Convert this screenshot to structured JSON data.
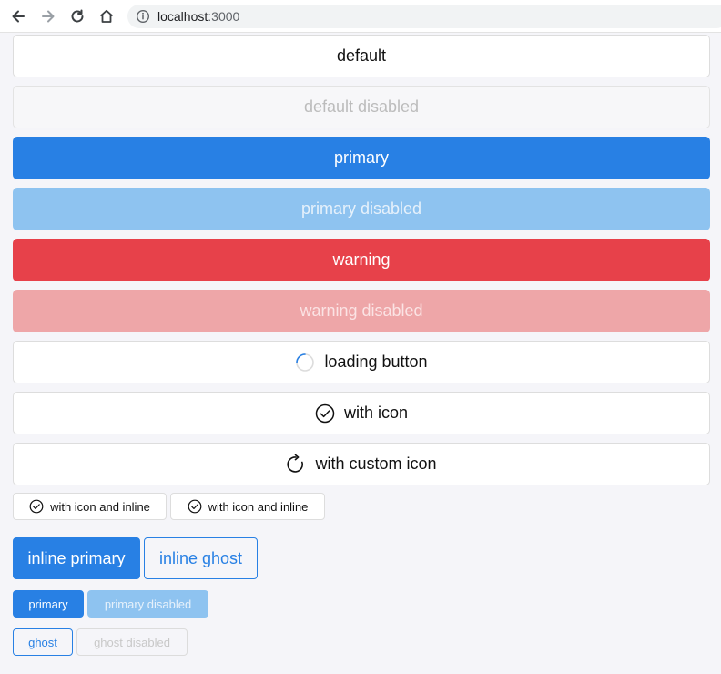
{
  "browser": {
    "url_host": "localhost",
    "url_port": ":3000"
  },
  "buttons": {
    "default": "default",
    "default_disabled": "default disabled",
    "primary": "primary",
    "primary_disabled": "primary disabled",
    "warning": "warning",
    "warning_disabled": "warning disabled",
    "loading": "loading button",
    "with_icon": "with icon",
    "with_custom_icon": "with custom icon"
  },
  "inline_icon_buttons": [
    {
      "label": "with icon and inline"
    },
    {
      "label": "with icon and inline"
    }
  ],
  "inline_large": {
    "primary": "inline primary",
    "ghost": "inline ghost"
  },
  "small_buttons": {
    "primary": "primary",
    "primary_disabled": "primary disabled",
    "ghost": "ghost",
    "ghost_disabled": "ghost disabled"
  },
  "colors": {
    "primary": "#2880e4",
    "warning": "#e7414a",
    "background": "#f5f5f9"
  },
  "icons": {
    "back": "arrow-left-icon",
    "forward": "arrow-right-icon",
    "reload": "reload-icon",
    "home": "home-icon",
    "info": "info-icon",
    "spinner": "spinner-icon",
    "check_circle": "check-circle-icon",
    "redo": "redo-icon"
  }
}
